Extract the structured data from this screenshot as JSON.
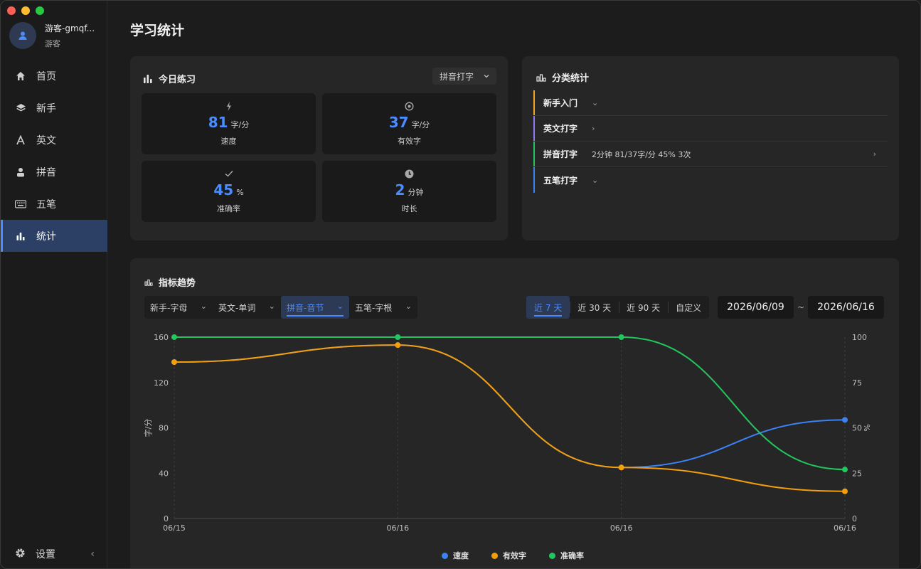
{
  "user": {
    "name": "游客-gmqf...",
    "role": "游客"
  },
  "nav": {
    "items": [
      {
        "key": "home",
        "label": "首页",
        "icon": "home-icon"
      },
      {
        "key": "beginner",
        "label": "新手",
        "icon": "layers-icon"
      },
      {
        "key": "english",
        "label": "英文",
        "icon": "letter-a-icon"
      },
      {
        "key": "pinyin",
        "label": "拼音",
        "icon": "person-icon"
      },
      {
        "key": "wubi",
        "label": "五笔",
        "icon": "keyboard-icon"
      },
      {
        "key": "stats",
        "label": "统计",
        "icon": "bar-chart-icon",
        "active": true
      }
    ],
    "settings_label": "设置",
    "collapse_glyph": "‹"
  },
  "page": {
    "title": "学习统计"
  },
  "today": {
    "title": "今日练习",
    "mode_select": "拼音打字",
    "tiles": {
      "speed": {
        "value": "81",
        "unit": "字/分",
        "label": "速度",
        "icon": "bolt-icon"
      },
      "effective": {
        "value": "37",
        "unit": "字/分",
        "label": "有效字",
        "icon": "target-icon"
      },
      "accuracy": {
        "value": "45",
        "unit": "%",
        "label": "准确率",
        "icon": "check-icon"
      },
      "duration": {
        "value": "2",
        "unit": "分钟",
        "label": "时长",
        "icon": "clock-icon"
      }
    }
  },
  "category": {
    "title": "分类统计",
    "rows": [
      {
        "name": "新手入门",
        "stat": "",
        "color": "#f5a623",
        "chevron": "⌄"
      },
      {
        "name": "英文打字",
        "stat": "",
        "color": "#8b7cf6",
        "chevron": "›"
      },
      {
        "name": "拼音打字",
        "stat": "2分钟 81/37字/分 45% 3次",
        "color": "#22c55e",
        "chevron": "›"
      },
      {
        "name": "五笔打字",
        "stat": "",
        "color": "#3b82f6",
        "chevron": "⌄"
      }
    ]
  },
  "trend": {
    "title": "指标趋势",
    "modes": [
      {
        "label": "新手-字母",
        "active": false
      },
      {
        "label": "英文-单词",
        "active": false
      },
      {
        "label": "拼音-音节",
        "active": true
      },
      {
        "label": "五笔-字根",
        "active": false
      }
    ],
    "ranges": [
      {
        "label": "近 7 天",
        "active": true
      },
      {
        "label": "近 30 天",
        "active": false
      },
      {
        "label": "近 90 天",
        "active": false
      },
      {
        "label": "自定义",
        "active": false
      }
    ],
    "date_from": "2026/06/09",
    "date_sep": "~",
    "date_to": "2026/06/16"
  },
  "colors": {
    "accent": "#4a8cff",
    "speed": "#3b82f6",
    "effective": "#f59e0b",
    "accuracy": "#22c55e"
  },
  "chart_data": {
    "type": "line",
    "x": [
      "06/15",
      "06/16",
      "06/16",
      "06/16"
    ],
    "ylabel": "字/分",
    "y2label": "%",
    "ylim": [
      0,
      160
    ],
    "y2lim": [
      0,
      100
    ],
    "yticks": [
      "160",
      "120",
      "80",
      "40",
      "0"
    ],
    "y2ticks": [
      "100",
      "75",
      "50",
      "25",
      "0"
    ],
    "series": [
      {
        "name": "速度",
        "axis": "left",
        "values": [
          138,
          153,
          45,
          87
        ]
      },
      {
        "name": "有效字",
        "axis": "left",
        "values": [
          138,
          153,
          45,
          24
        ]
      },
      {
        "name": "准确率",
        "axis": "right",
        "values": [
          100,
          100,
          100,
          27
        ]
      }
    ],
    "legend": "bottom",
    "grid": "vertical dashed"
  }
}
